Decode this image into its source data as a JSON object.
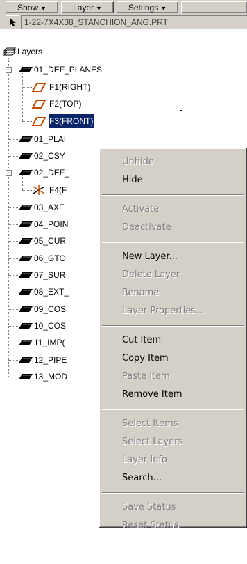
{
  "toolbar": {
    "show_label": "Show",
    "layer_label": "Layer",
    "settings_label": "Settings",
    "dropdown_arrow": "▼",
    "model_name": "1-22-7X4X38_STANCHION_ANG.PRT"
  },
  "tree": {
    "root_label": "Layers",
    "nodes": [
      {
        "label": "01_DEF_PLANES"
      },
      {
        "label": "F1(RIGHT)"
      },
      {
        "label": "F2(TOP)"
      },
      {
        "label": "F3(FRONT)"
      },
      {
        "label": "01_PLAI"
      },
      {
        "label": "02_CSY"
      },
      {
        "label": "02_DEF_"
      },
      {
        "label": "F4(F"
      },
      {
        "label": "03_AXE"
      },
      {
        "label": "04_POIN"
      },
      {
        "label": "05_CUR"
      },
      {
        "label": "06_GTO"
      },
      {
        "label": "07_SUR"
      },
      {
        "label": "08_EXT_"
      },
      {
        "label": "09_COS"
      },
      {
        "label": "10_COS"
      },
      {
        "label": "11_IMP("
      },
      {
        "label": "12_PIPE"
      },
      {
        "label": "13_MOD"
      }
    ],
    "selected_label": "F3(FRONT)"
  },
  "context_menu": {
    "items": [
      {
        "label": "Unhide",
        "enabled": false
      },
      {
        "label": "Hide",
        "enabled": true
      },
      {
        "label": "Activate",
        "enabled": false
      },
      {
        "label": "Deactivate",
        "enabled": false
      },
      {
        "label": "New Layer...",
        "enabled": true
      },
      {
        "label": "Delete Layer",
        "enabled": false
      },
      {
        "label": "Rename",
        "enabled": false
      },
      {
        "label": "Layer Properties...",
        "enabled": false
      },
      {
        "label": "Cut Item",
        "enabled": true
      },
      {
        "label": "Copy Item",
        "enabled": true
      },
      {
        "label": "Paste Item",
        "enabled": false
      },
      {
        "label": "Remove Item",
        "enabled": true
      },
      {
        "label": "Select Items",
        "enabled": false
      },
      {
        "label": "Select Layers",
        "enabled": false
      },
      {
        "label": "Layer Info",
        "enabled": false
      },
      {
        "label": "Search...",
        "enabled": true
      },
      {
        "label": "Save Status",
        "enabled": false
      },
      {
        "label": "Reset Status",
        "enabled": false
      }
    ]
  },
  "colors": {
    "face": "#d4d0c8",
    "selection": "#0a246a",
    "plane_icon": "#c04a00",
    "disabled_text": "#808080"
  }
}
